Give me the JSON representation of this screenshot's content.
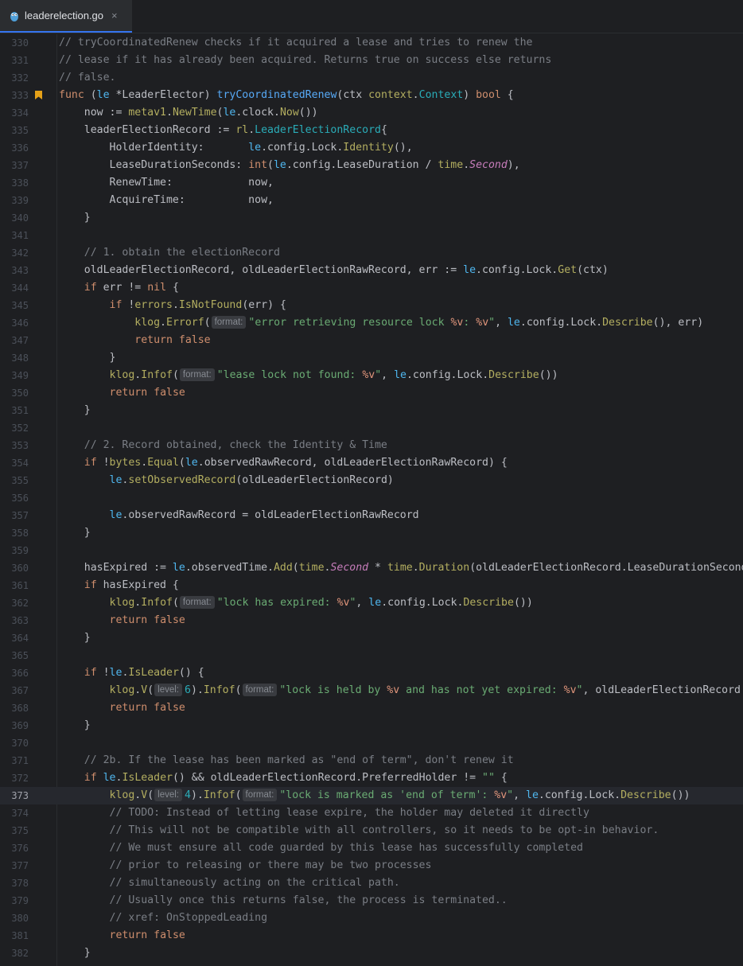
{
  "tab": {
    "filename": "leaderelection.go",
    "close": "×"
  },
  "hints": {
    "format": "format:",
    "level": "level:"
  },
  "lines": [
    {
      "n": "330"
    },
    {
      "n": "331"
    },
    {
      "n": "332"
    },
    {
      "n": "333"
    },
    {
      "n": "334"
    },
    {
      "n": "335"
    },
    {
      "n": "336"
    },
    {
      "n": "337"
    },
    {
      "n": "338"
    },
    {
      "n": "339"
    },
    {
      "n": "340"
    },
    {
      "n": "341"
    },
    {
      "n": "342"
    },
    {
      "n": "343"
    },
    {
      "n": "344"
    },
    {
      "n": "345"
    },
    {
      "n": "346"
    },
    {
      "n": "347"
    },
    {
      "n": "348"
    },
    {
      "n": "349"
    },
    {
      "n": "350"
    },
    {
      "n": "351"
    },
    {
      "n": "352"
    },
    {
      "n": "353"
    },
    {
      "n": "354"
    },
    {
      "n": "355"
    },
    {
      "n": "356"
    },
    {
      "n": "357"
    },
    {
      "n": "358"
    },
    {
      "n": "359"
    },
    {
      "n": "360"
    },
    {
      "n": "361"
    },
    {
      "n": "362"
    },
    {
      "n": "363"
    },
    {
      "n": "364"
    },
    {
      "n": "365"
    },
    {
      "n": "366"
    },
    {
      "n": "367"
    },
    {
      "n": "368"
    },
    {
      "n": "369"
    },
    {
      "n": "370"
    },
    {
      "n": "371"
    },
    {
      "n": "372"
    },
    {
      "n": "373"
    },
    {
      "n": "374"
    },
    {
      "n": "375"
    },
    {
      "n": "376"
    },
    {
      "n": "377"
    },
    {
      "n": "378"
    },
    {
      "n": "379"
    },
    {
      "n": "380"
    },
    {
      "n": "381"
    },
    {
      "n": "382"
    }
  ],
  "code": {
    "l330": "// tryCoordinatedRenew checks if it acquired a lease and tries to renew the",
    "l331": "// lease if it has already been acquired. Returns true on success else returns",
    "l332": "// false.",
    "l333": "func (le *LeaderElector) tryCoordinatedRenew(ctx context.Context) bool {",
    "l334": "    now := metav1.NewTime(le.clock.Now())",
    "l335": "    leaderElectionRecord := rl.LeaderElectionRecord{",
    "l336": "        HolderIdentity:       le.config.Lock.Identity(),",
    "l337": "        LeaseDurationSeconds: int(le.config.LeaseDuration / time.Second),",
    "l338": "        RenewTime:            now,",
    "l339": "        AcquireTime:          now,",
    "l340": "    }",
    "l342": "    // 1. obtain the electionRecord",
    "l343": "    oldLeaderElectionRecord, oldLeaderElectionRawRecord, err := le.config.Lock.Get(ctx)",
    "l344": "    if err != nil {",
    "l345": "        if !errors.IsNotFound(err) {",
    "l346": "            klog.Errorf( \"error retrieving resource lock %v: %v\", le.config.Lock.Describe(), err)",
    "l347": "            return false",
    "l348": "        }",
    "l349": "        klog.Infof( \"lease lock not found: %v\", le.config.Lock.Describe())",
    "l350": "        return false",
    "l351": "    }",
    "l353": "    // 2. Record obtained, check the Identity & Time",
    "l354": "    if !bytes.Equal(le.observedRawRecord, oldLeaderElectionRawRecord) {",
    "l355": "        le.setObservedRecord(oldLeaderElectionRecord)",
    "l357": "        le.observedRawRecord = oldLeaderElectionRawRecord",
    "l358": "    }",
    "l360": "    hasExpired := le.observedTime.Add(time.Second * time.Duration(oldLeaderElectionRecord.LeaseDurationSeconds)",
    "l361": "    if hasExpired {",
    "l362": "        klog.Infof( \"lock has expired: %v\", le.config.Lock.Describe())",
    "l363": "        return false",
    "l364": "    }",
    "l366": "    if !le.IsLeader() {",
    "l367": "        klog.V( 6).Infof( \"lock is held by %v and has not yet expired: %v\", oldLeaderElectionRecord.",
    "l368": "        return false",
    "l369": "    }",
    "l371": "    // 2b. If the lease has been marked as \"end of term\", don't renew it",
    "l372": "    if le.IsLeader() && oldLeaderElectionRecord.PreferredHolder != \"\" {",
    "l373": "        klog.V( 4).Infof( \"lock is marked as 'end of term': %v\", le.config.Lock.Describe())",
    "l374": "        // TODO: Instead of letting lease expire, the holder may deleted it directly",
    "l375": "        // This will not be compatible with all controllers, so it needs to be opt-in behavior.",
    "l376": "        // We must ensure all code guarded by this lease has successfully completed",
    "l377": "        // prior to releasing or there may be two processes",
    "l378": "        // simultaneously acting on the critical path.",
    "l379": "        // Usually once this returns false, the process is terminated..",
    "l380": "        // xref: OnStoppedLeading",
    "l381": "        return false",
    "l382": "    }"
  }
}
